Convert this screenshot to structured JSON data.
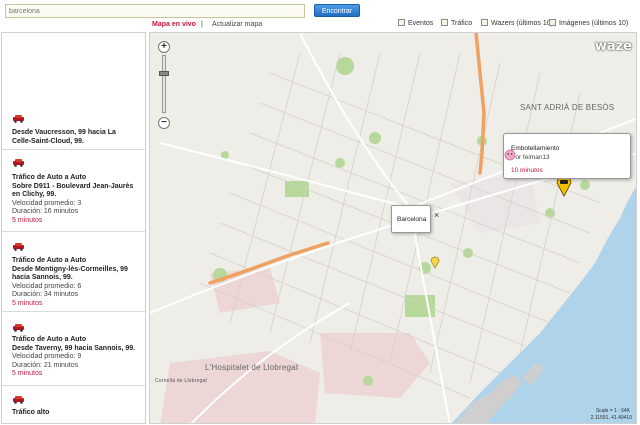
{
  "search": {
    "value": "barcelona",
    "button_label": "Encontrar"
  },
  "tabs": {
    "live": "Mapa en vivo",
    "separator": "|",
    "update": "Actualizar mapa"
  },
  "filters": [
    {
      "label": "Eventos"
    },
    {
      "label": "Tráfico"
    },
    {
      "label": "Wazers (últimos 10)"
    },
    {
      "label": "Imágenes (últimos 10)"
    }
  ],
  "sidebar": {
    "reports": [
      {
        "icon": "car-icon",
        "lines": [
          "Desde Vaucresson, 99 hacia La",
          "Celle-Saint-Cloud, 99."
        ],
        "meta": [],
        "time": ""
      },
      {
        "icon": "car-icon",
        "title": "Tráfico de Auto a Auto",
        "lines": [
          "Sobre D911 - Boulevard Jean-Jaurès",
          "en Clichy, 99."
        ],
        "meta": [
          "Velocidad promedio: 3",
          "Duración: 16 minutos"
        ],
        "time": "5 minutos"
      },
      {
        "icon": "car-icon",
        "title": "Tráfico de Auto a Auto",
        "lines": [
          "Desde Montigny-lès-Cormeilles, 99",
          "hacia Sannois, 99."
        ],
        "meta": [
          "Velocidad promedio: 6",
          "Duración: 34 minutos"
        ],
        "time": "5 minutos"
      },
      {
        "icon": "car-icon",
        "title": "Tráfico de Auto a Auto",
        "lines": [
          "Desde Taverny, 99 hacia Sannois, 99."
        ],
        "meta": [
          "Velocidad promedio: 9",
          "Duración: 21 minutos"
        ],
        "time": "5 minutos"
      },
      {
        "icon": "car-icon",
        "title": "Tráfico alto",
        "lines": [],
        "meta": [],
        "time": ""
      }
    ]
  },
  "map": {
    "brand": "waze",
    "labels": {
      "sant_adria": "SANT ADRIÀ DE BESÒS",
      "hospitalet": "L'Hospitalet de Llobregat",
      "cornella": "Cornellà de Llobregat"
    },
    "popup_city": {
      "title": "Barcelona",
      "close": "×"
    },
    "popup_jam": {
      "title": "Embotellamiento",
      "user": "Por feiman13",
      "time": "10 minutos"
    },
    "scale": "Scale = 1 : 64K",
    "coords": "2.11591, 41.40410"
  },
  "colors": {
    "accent": "#c0183b",
    "traffic": "#f0a060",
    "button": "#2f80d1"
  }
}
